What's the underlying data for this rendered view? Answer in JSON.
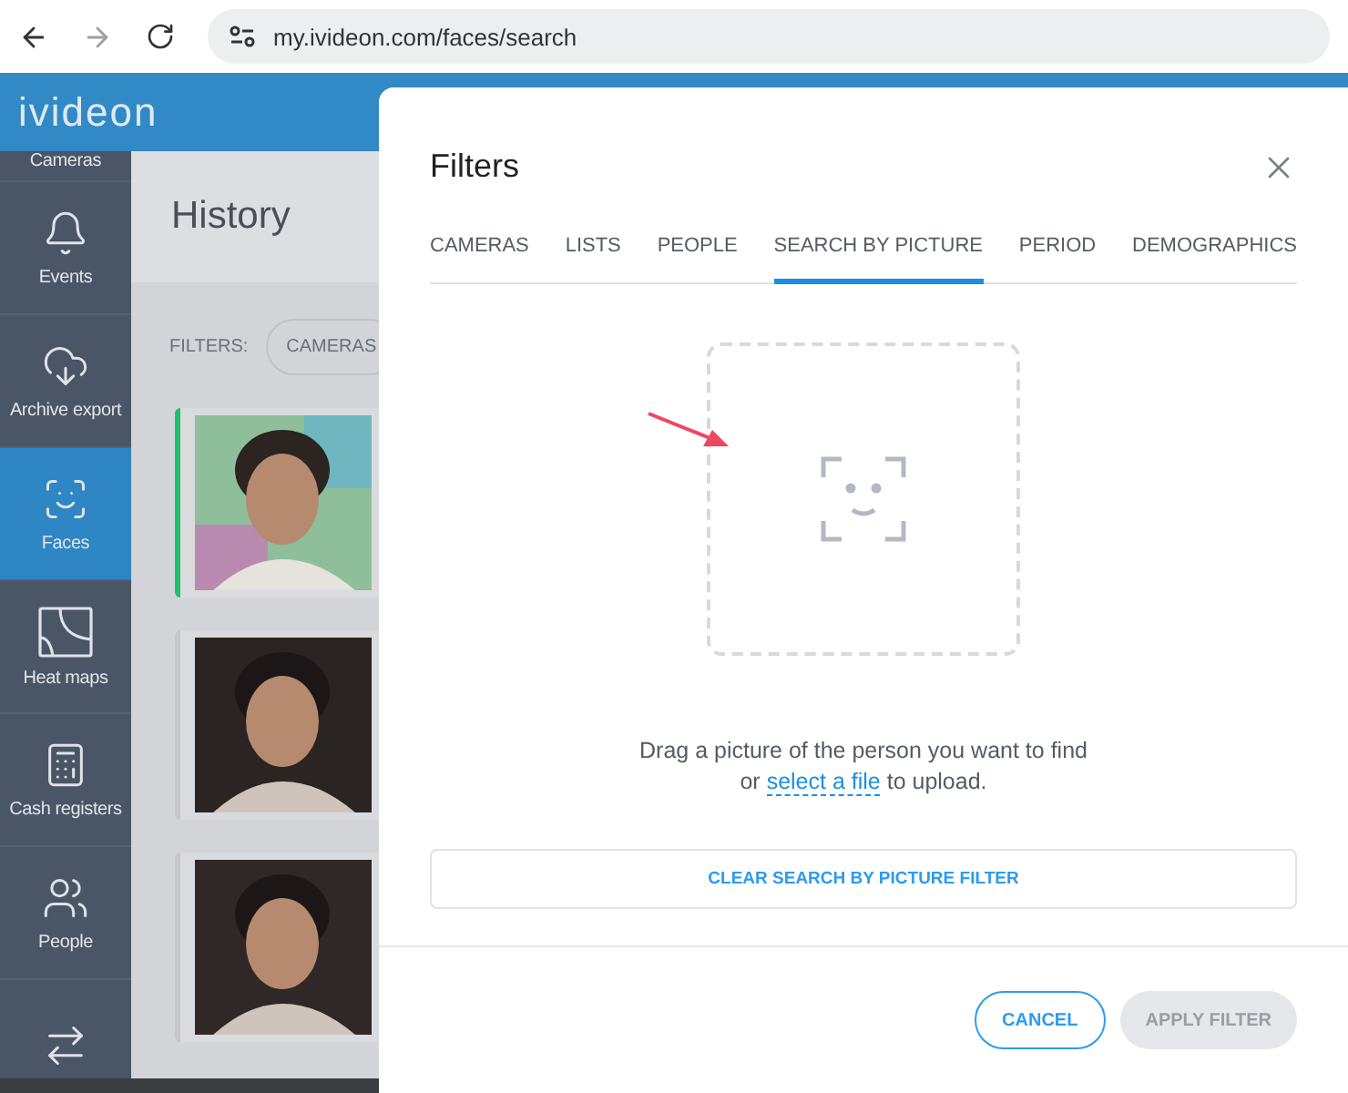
{
  "browser": {
    "url": "my.ivideon.com/faces/search"
  },
  "app": {
    "logo": "ivideon"
  },
  "sidebar": {
    "items": [
      {
        "label": "Cameras",
        "selected": false
      },
      {
        "kind": "events",
        "label": "Events",
        "selected": false
      },
      {
        "kind": "archive",
        "label": "Archive export",
        "selected": false
      },
      {
        "kind": "faces",
        "label": "Faces",
        "selected": true
      },
      {
        "kind": "heatmaps",
        "label": "Heat maps",
        "selected": false
      },
      {
        "kind": "cash",
        "label": "Cash registers",
        "selected": false
      },
      {
        "kind": "people",
        "label": "People",
        "selected": false
      },
      {
        "kind": "visits",
        "selected": false
      }
    ]
  },
  "history": {
    "title": "History",
    "filters_label": "FILTERS:",
    "filter_chips": [
      "CAMERAS"
    ],
    "cards": [
      {
        "kind": "picture",
        "highlighted": true
      },
      {
        "kind": "picture",
        "highlighted": false
      },
      {
        "kind": "picture",
        "highlighted": false
      }
    ]
  },
  "dialog": {
    "title": "Filters",
    "tabs": [
      {
        "label": "CAMERAS",
        "selected": false
      },
      {
        "label": "LISTS",
        "selected": false
      },
      {
        "label": "PEOPLE",
        "selected": false
      },
      {
        "label": "SEARCH BY PICTURE",
        "selected": true
      },
      {
        "label": "PERIOD",
        "selected": false
      },
      {
        "label": "DEMOGRAPHICS",
        "selected": false
      }
    ],
    "drop_hint": {
      "line1": "Drag a picture of the person you want to find",
      "prefix": "or",
      "link": "select a file",
      "suffix": "to upload."
    },
    "clear_button": "CLEAR SEARCH BY PICTURE FILTER",
    "buttons": [
      {
        "kind": "outline",
        "label": "CANCEL"
      },
      {
        "kind": "filled",
        "label": "APPLY FILTER",
        "disabled": true
      }
    ]
  }
}
